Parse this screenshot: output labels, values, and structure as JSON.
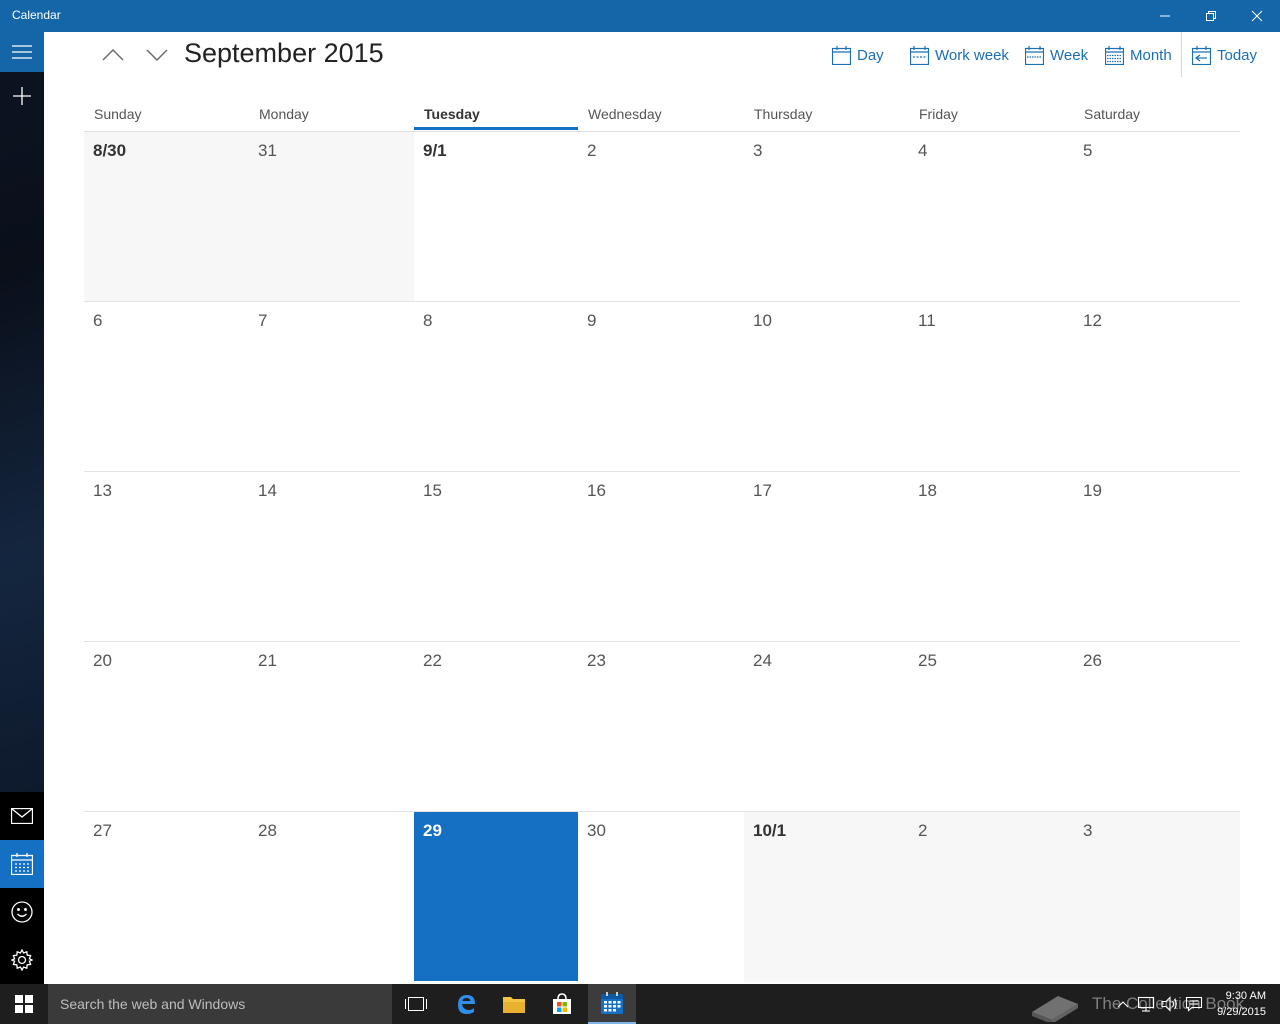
{
  "window": {
    "title": "Calendar"
  },
  "header": {
    "month_title": "September 2015",
    "views": [
      {
        "label": "Day",
        "icon": "day-view-icon"
      },
      {
        "label": "Work week",
        "icon": "work-week-view-icon"
      },
      {
        "label": "Week",
        "icon": "week-view-icon"
      },
      {
        "label": "Month",
        "icon": "month-view-icon"
      },
      {
        "label": "Today",
        "icon": "today-icon"
      }
    ]
  },
  "weekdays": [
    "Sunday",
    "Monday",
    "Tuesday",
    "Wednesday",
    "Thursday",
    "Friday",
    "Saturday"
  ],
  "today_weekday": "Tuesday",
  "weeks": [
    [
      "8/30",
      "31",
      "9/1",
      "2",
      "3",
      "4",
      "5"
    ],
    [
      "6",
      "7",
      "8",
      "9",
      "10",
      "11",
      "12"
    ],
    [
      "13",
      "14",
      "15",
      "16",
      "17",
      "18",
      "19"
    ],
    [
      "20",
      "21",
      "22",
      "23",
      "24",
      "25",
      "26"
    ],
    [
      "27",
      "28",
      "29",
      "30",
      "10/1",
      "2",
      "3"
    ]
  ],
  "today_date": "29",
  "colors": {
    "accent": "#1570c4",
    "titlebar": "#1566a8",
    "other_month_bg": "#f7f7f7"
  },
  "taskbar": {
    "search_placeholder": "Search the web and Windows",
    "clock_time": "9:30 AM",
    "clock_date": "9/29/2015",
    "watermark": "The Collection Book"
  }
}
